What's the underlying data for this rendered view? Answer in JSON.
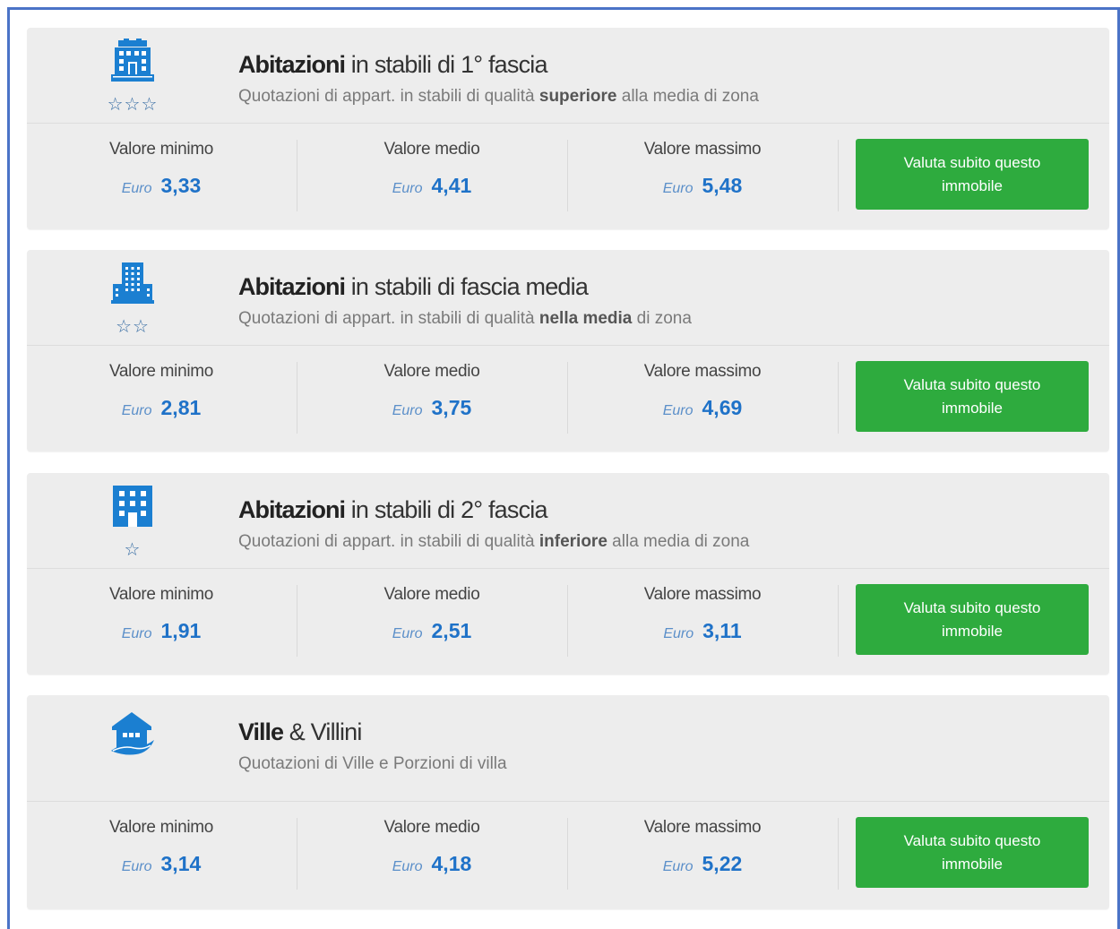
{
  "colors": {
    "frame": "#4b73c7",
    "card_bg": "#ededed",
    "value": "#1f72c8",
    "button": "#2eab3e",
    "icon": "#1b7fd1"
  },
  "cards": [
    {
      "icon": "building-fancy-icon",
      "stars": "☆☆☆",
      "title_bold": "Abitazioni",
      "title_rest": " in stabili di 1° fascia",
      "sub_pre": "Quotazioni di appart. in stabili di qualità ",
      "sub_bold": "superiore",
      "sub_post": " alla media di zona",
      "min_label": "Valore minimo",
      "min_currency": "Euro",
      "min_value": "3,33",
      "med_label": "Valore medio",
      "med_currency": "Euro",
      "med_value": "4,41",
      "max_label": "Valore massimo",
      "max_currency": "Euro",
      "max_value": "5,48",
      "cta": "Valuta subito questo immobile"
    },
    {
      "icon": "office-tower-icon",
      "stars": "☆☆",
      "title_bold": "Abitazioni",
      "title_rest": " in stabili di fascia media",
      "sub_pre": "Quotazioni di appart. in stabili di qualità ",
      "sub_bold": "nella media",
      "sub_post": " di zona",
      "min_label": "Valore minimo",
      "min_currency": "Euro",
      "min_value": "2,81",
      "med_label": "Valore medio",
      "med_currency": "Euro",
      "med_value": "3,75",
      "max_label": "Valore massimo",
      "max_currency": "Euro",
      "max_value": "4,69",
      "cta": "Valuta subito questo immobile"
    },
    {
      "icon": "apartment-block-icon",
      "stars": "☆",
      "title_bold": "Abitazioni",
      "title_rest": " in stabili di 2° fascia",
      "sub_pre": "Quotazioni di appart. in stabili di qualità ",
      "sub_bold": "inferiore",
      "sub_post": " alla media di zona",
      "min_label": "Valore minimo",
      "min_currency": "Euro",
      "min_value": "1,91",
      "med_label": "Valore medio",
      "med_currency": "Euro",
      "med_value": "2,51",
      "max_label": "Valore massimo",
      "max_currency": "Euro",
      "max_value": "3,11",
      "cta": "Valuta subito questo immobile"
    },
    {
      "icon": "villa-house-icon",
      "stars": "",
      "title_bold": "Ville",
      "title_rest": " & Villini",
      "sub_pre": "Quotazioni di Ville e Porzioni di villa",
      "sub_bold": "",
      "sub_post": "",
      "min_label": "Valore minimo",
      "min_currency": "Euro",
      "min_value": "3,14",
      "med_label": "Valore medio",
      "med_currency": "Euro",
      "med_value": "4,18",
      "max_label": "Valore massimo",
      "max_currency": "Euro",
      "max_value": "5,22",
      "cta": "Valuta subito questo immobile"
    }
  ]
}
